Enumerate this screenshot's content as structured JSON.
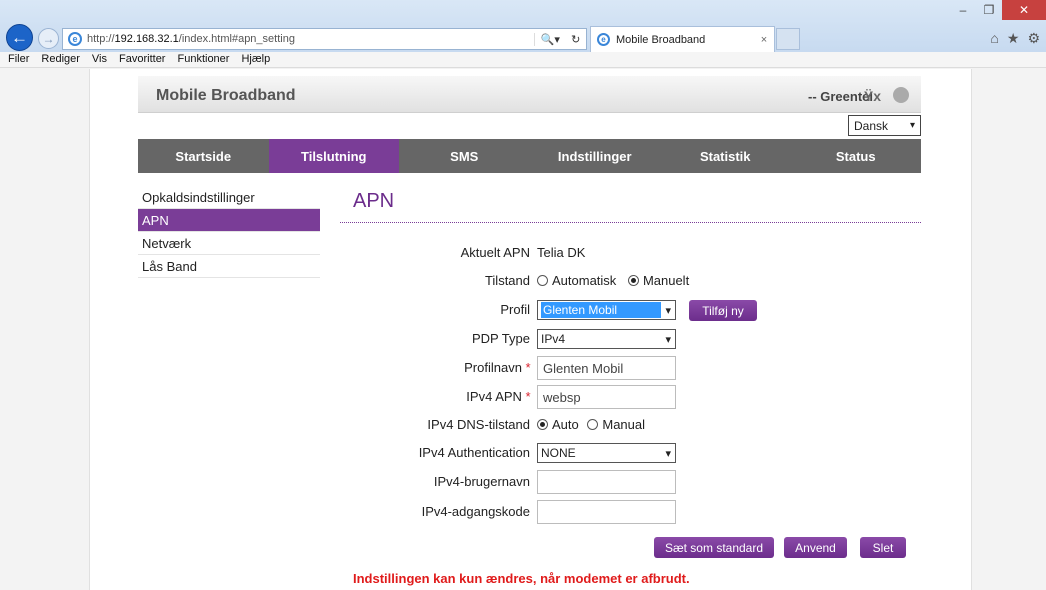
{
  "browser": {
    "url_prefix": "http://",
    "url_host": "192.168.32.1",
    "url_path": "/index.html#apn_setting",
    "search_icon": "🔍▾",
    "refresh_icon": "↻",
    "tab_title": "Mobile Broadband",
    "tab_close": "×",
    "window_min": "–",
    "window_restore": "❐",
    "window_close": "✕",
    "home_icon": "⌂",
    "star_icon": "★",
    "gear_icon": "⚙",
    "back_icon": "←",
    "forward_icon": "→",
    "ie_icon": "e"
  },
  "menubar": [
    "Filer",
    "Rediger",
    "Vis",
    "Favoritter",
    "Funktioner",
    "Hjælp"
  ],
  "header": {
    "brand": "Mobile Broadband",
    "operator": "-- Greentel",
    "signal_icon": "Ÿx"
  },
  "language": {
    "selected": "Dansk",
    "chevron": "▾"
  },
  "nav": [
    {
      "label": "Startside"
    },
    {
      "label": "Tilslutning",
      "active": true
    },
    {
      "label": "SMS"
    },
    {
      "label": "Indstillinger"
    },
    {
      "label": "Statistik"
    },
    {
      "label": "Status"
    }
  ],
  "sidemenu": [
    {
      "label": "Opkaldsindstillinger"
    },
    {
      "label": "APN",
      "active": true
    },
    {
      "label": "Netværk"
    },
    {
      "label": "Lås Band"
    }
  ],
  "section_title": "APN",
  "form": {
    "current_apn_label": "Aktuelt APN",
    "current_apn_value": "Telia DK",
    "mode_label": "Tilstand",
    "mode_auto": "Automatisk",
    "mode_manual": "Manuelt",
    "profile_label": "Profil",
    "profile_value": "Glenten Mobil",
    "add_new_button": "Tilføj ny",
    "pdp_label": "PDP Type",
    "pdp_value": "IPv4",
    "profile_name_label": "Profilnavn",
    "profile_name_value": "Glenten Mobil",
    "ipv4_apn_label": "IPv4 APN",
    "ipv4_apn_value": "websp",
    "dns_label": "IPv4 DNS-tilstand",
    "dns_auto": "Auto",
    "dns_manual": "Manual",
    "auth_label": "IPv4 Authentication",
    "auth_value": "NONE",
    "username_label": "IPv4-brugernavn",
    "username_value": "",
    "password_label": "IPv4-adgangskode",
    "password_value": "",
    "required_mark": "*",
    "chevron": "▾"
  },
  "buttons": {
    "set_default": "Sæt som standard",
    "apply": "Anvend",
    "delete": "Slet"
  },
  "note": "Indstillingen kan kun ændres, når modemet er afbrudt."
}
